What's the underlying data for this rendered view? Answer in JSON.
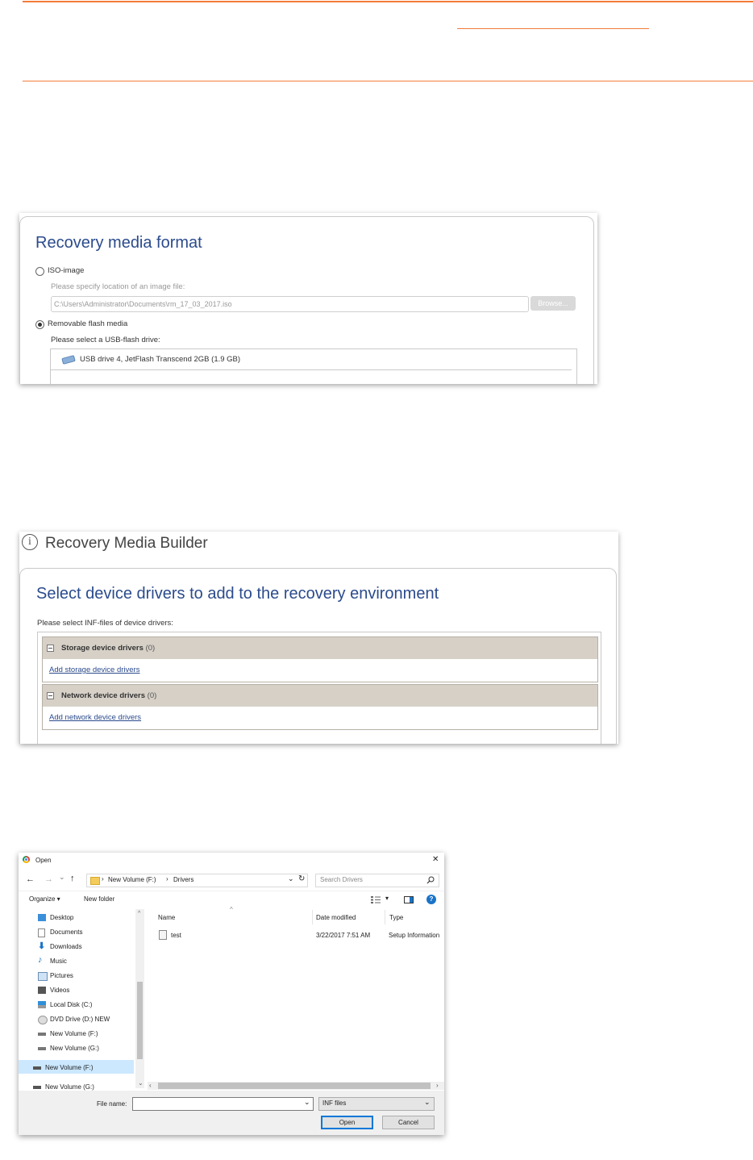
{
  "panel1": {
    "title": "Recovery media format",
    "iso_option": "ISO-image",
    "iso_hint": "Please specify location of an image file:",
    "iso_path": "C:\\Users\\Administrator\\Documents\\rm_17_03_2017.iso",
    "browse": "Browse...",
    "flash_option": "Removable flash media",
    "flash_hint": "Please select a USB-flash drive:",
    "usb_item": "USB drive 4, JetFlash Transcend 2GB (1.9 GB)"
  },
  "panel2": {
    "app_title": "Recovery Media Builder",
    "title": "Select device drivers to add to the recovery environment",
    "instruction": "Please select INF-files of device drivers:",
    "groups": [
      {
        "name": "Storage device drivers",
        "count": "(0)",
        "link": "Add storage device drivers"
      },
      {
        "name": "Network device drivers",
        "count": "(0)",
        "link": "Add network device drivers"
      }
    ]
  },
  "panel3": {
    "window_title": "Open",
    "close": "✕",
    "nav_back": "←",
    "nav_forward": "→",
    "nav_recent": "⌄",
    "nav_up": "↑",
    "breadcrumb": [
      "New Volume (F:)",
      "Drivers"
    ],
    "breadcrumb_sep": "›",
    "refresh": "↻",
    "search_placeholder": "Search Drivers",
    "organize": "Organize ▾",
    "new_folder": "New folder",
    "view_arrow": "▾",
    "help": "?",
    "sort_caret": "^",
    "nav_items": [
      "Desktop",
      "Documents",
      "Downloads",
      "Music",
      "Pictures",
      "Videos",
      "Local Disk (C:)",
      "DVD Drive (D:) NEW",
      "New Volume (F:)",
      "New Volume (G:)"
    ],
    "nav_selected": "New Volume (F:)",
    "nav_last": "New Volume (G:)",
    "columns": {
      "name": "Name",
      "date": "Date modified",
      "type": "Type"
    },
    "files": [
      {
        "name": "test",
        "date": "3/22/2017 7:51 AM",
        "type": "Setup Information"
      }
    ],
    "file_name_label": "File name:",
    "file_name_value": "",
    "file_type": "INF files",
    "open_button": "Open",
    "cancel_button": "Cancel"
  },
  "colors": {
    "accent_rule": "#f47b3a",
    "title_blue": "#2b4b8c",
    "group_header": "#d6d0c7"
  }
}
